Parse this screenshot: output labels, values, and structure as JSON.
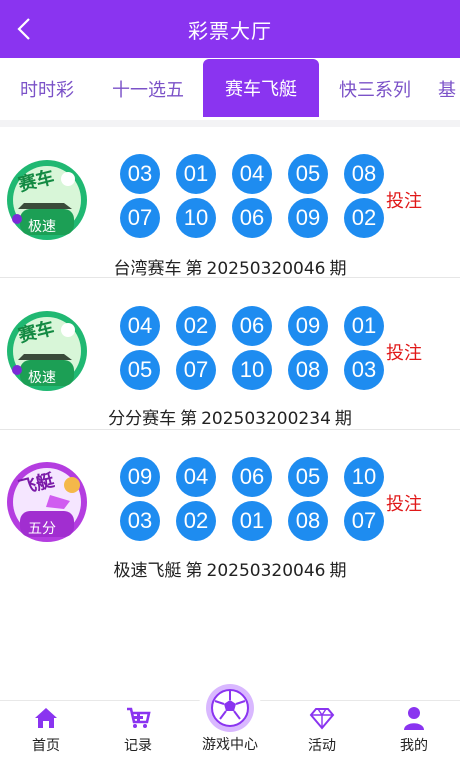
{
  "header": {
    "title": "彩票大厅"
  },
  "tabs": [
    "时时彩",
    "十一选五",
    "赛车飞艇",
    "快三系列",
    "基"
  ],
  "active_tab": "赛车飞艇",
  "lotteries": [
    {
      "logo_text": "赛车",
      "logo_badge": "极速",
      "logo_color": "#1fb86a",
      "balls": [
        "03",
        "01",
        "04",
        "05",
        "08",
        "07",
        "10",
        "06",
        "09",
        "02"
      ],
      "bet_label": "投注",
      "name": "台湾赛车",
      "prefix": "第",
      "period": "20250320046",
      "suffix": "期"
    },
    {
      "logo_text": "赛车",
      "logo_badge": "极速",
      "logo_color": "#1fb86a",
      "balls": [
        "04",
        "02",
        "06",
        "09",
        "01",
        "05",
        "07",
        "10",
        "08",
        "03"
      ],
      "bet_label": "投注",
      "name": "分分赛车",
      "prefix": "第",
      "period": "202503200234",
      "suffix": "期"
    },
    {
      "logo_text": "飞艇",
      "logo_badge": "五分",
      "logo_color": "#b43de0",
      "balls": [
        "09",
        "04",
        "06",
        "05",
        "10",
        "03",
        "02",
        "01",
        "08",
        "07"
      ],
      "bet_label": "投注",
      "name": "极速飞艇",
      "prefix": "第",
      "period": "20250320046",
      "suffix": "期"
    }
  ],
  "bottom_nav": {
    "home": "首页",
    "records": "记录",
    "game_center": "游戏中心",
    "activity": "活动",
    "mine": "我的"
  },
  "colors": {
    "primary": "#8a34f0",
    "ball": "#1e8cf0",
    "bet": "#e01818"
  }
}
